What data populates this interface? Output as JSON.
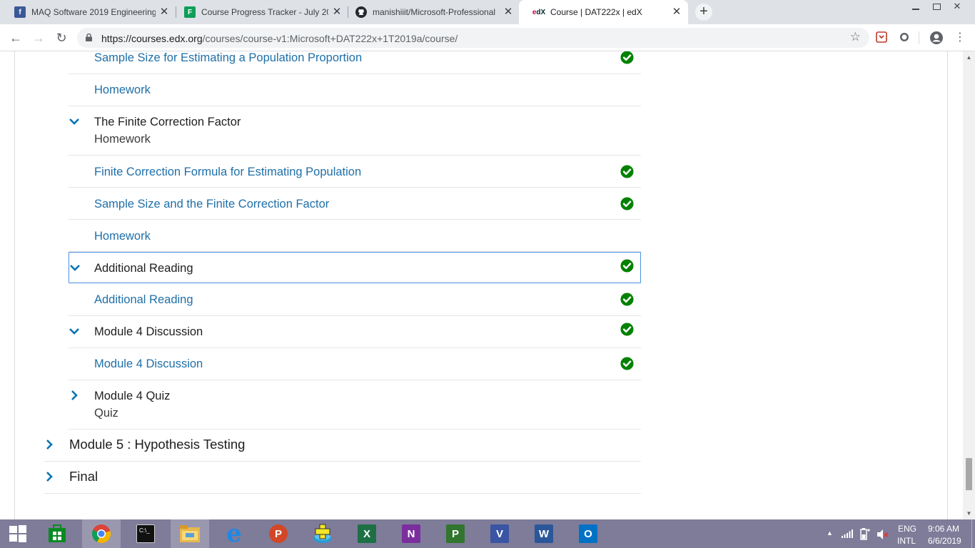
{
  "browser": {
    "tabs": [
      {
        "title": "MAQ Software 2019 Engineering",
        "icon": "facebook-icon",
        "color": "#3b5998",
        "glyph": "f",
        "active": false
      },
      {
        "title": "Course Progress Tracker - July 20",
        "icon": "google-sheets-icon",
        "color": "#0f9d58",
        "glyph": "F",
        "active": false
      },
      {
        "title": "manishiiit/Microsoft-Professional",
        "icon": "github-icon",
        "color": "#24292e",
        "glyph": "",
        "active": false
      },
      {
        "title": "Course | DAT222x | edX",
        "icon": "edx-icon",
        "color": "#02262b",
        "glyph": "",
        "active": true
      }
    ],
    "new_tab_label": "+",
    "url_host": "https://courses.edx.org",
    "url_path": "/courses/course-v1:Microsoft+DAT222x+1T2019a/course/"
  },
  "outline": {
    "rows": [
      {
        "type": "leaf",
        "label": "Sample Size for Estimating a Population Proportion",
        "complete": true
      },
      {
        "type": "leaf",
        "label": "Homework",
        "complete": false
      },
      {
        "type": "subsection",
        "label": "The Finite Correction Factor",
        "sublabel": "Homework",
        "expanded": true,
        "complete": false
      },
      {
        "type": "leaf",
        "label": "Finite Correction Formula for Estimating Population",
        "complete": true
      },
      {
        "type": "leaf",
        "label": "Sample Size and the Finite Correction Factor",
        "complete": true
      },
      {
        "type": "leaf",
        "label": "Homework",
        "complete": false
      },
      {
        "type": "subsection",
        "label": "Additional Reading",
        "sublabel": "",
        "expanded": true,
        "complete": true,
        "focused": true
      },
      {
        "type": "leaf",
        "label": "Additional Reading",
        "complete": true
      },
      {
        "type": "subsection",
        "label": "Module 4 Discussion",
        "sublabel": "",
        "expanded": true,
        "complete": true
      },
      {
        "type": "leaf",
        "label": "Module 4 Discussion",
        "complete": true
      },
      {
        "type": "subsection",
        "label": "Module 4 Quiz",
        "sublabel": "Quiz",
        "expanded": false,
        "complete": false
      },
      {
        "type": "section",
        "label": "Module 5 : Hypothesis Testing",
        "expanded": false
      },
      {
        "type": "section",
        "label": "Final",
        "expanded": false
      }
    ]
  },
  "taskbar": {
    "apps": [
      {
        "name": "store",
        "color": "#0a8a22",
        "glyph": "",
        "running": false
      },
      {
        "name": "chrome",
        "color": "",
        "glyph": "",
        "running": true
      },
      {
        "name": "command-prompt",
        "color": "#111111",
        "glyph": "C:\\",
        "running": false
      },
      {
        "name": "file-explorer",
        "color": "#e8b84a",
        "glyph": "",
        "running": true
      },
      {
        "name": "internet-explorer",
        "color": "#1e88e5",
        "glyph": "e",
        "running": false
      },
      {
        "name": "powerpoint",
        "color": "#d24726",
        "glyph": "P",
        "running": false
      },
      {
        "name": "first-aid-app",
        "color": "#2b9bd6",
        "glyph": "✚",
        "running": false
      },
      {
        "name": "excel",
        "color": "#1d7044",
        "glyph": "X",
        "running": false
      },
      {
        "name": "onenote",
        "color": "#7b2f9e",
        "glyph": "N",
        "running": false
      },
      {
        "name": "project",
        "color": "#31752f",
        "glyph": "P",
        "running": false
      },
      {
        "name": "visio",
        "color": "#3955a3",
        "glyph": "V",
        "running": false
      },
      {
        "name": "word",
        "color": "#2b579a",
        "glyph": "W",
        "running": false
      },
      {
        "name": "outlook",
        "color": "#0072c6",
        "glyph": "O",
        "running": false
      }
    ],
    "lang_top": "ENG",
    "lang_bottom": "INTL",
    "time": "9:06 AM",
    "date": "6/6/2019"
  },
  "colors": {
    "link": "#1f6fa8",
    "check": "#008100",
    "chevron": "#0075b4"
  }
}
